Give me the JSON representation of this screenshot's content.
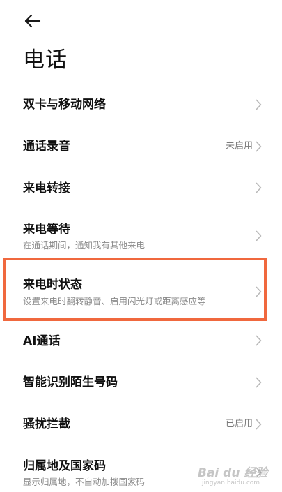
{
  "page": {
    "title": "电话"
  },
  "items": [
    {
      "title": "双卡与移动网络",
      "subtitle": "",
      "value": ""
    },
    {
      "title": "通话录音",
      "subtitle": "",
      "value": "未启用"
    },
    {
      "title": "来电转接",
      "subtitle": "",
      "value": ""
    },
    {
      "title": "来电等待",
      "subtitle": "在通话期间，通知我有其他来电",
      "value": ""
    },
    {
      "title": "来电时状态",
      "subtitle": "设置来电时翻转静音、启用闪光灯或距离感应等",
      "value": ""
    },
    {
      "title": "AI通话",
      "subtitle": "",
      "value": ""
    },
    {
      "title": "智能识别陌生号码",
      "subtitle": "",
      "value": ""
    },
    {
      "title": "骚扰拦截",
      "subtitle": "",
      "value": "已启用"
    },
    {
      "title": "归属地及国家码",
      "subtitle": "显示归属地，不自动加拨国家码",
      "value": ""
    }
  ],
  "watermark": {
    "brand": "Bai du 经验",
    "url": "jingyan.baidu.com"
  },
  "colors": {
    "highlight": "#f0683e",
    "title": "#111111",
    "subtitle": "#8a8a8a",
    "chevron": "#b8b8b8"
  },
  "icons": {
    "back": "arrow-left-icon",
    "chevron": "chevron-right-icon"
  }
}
